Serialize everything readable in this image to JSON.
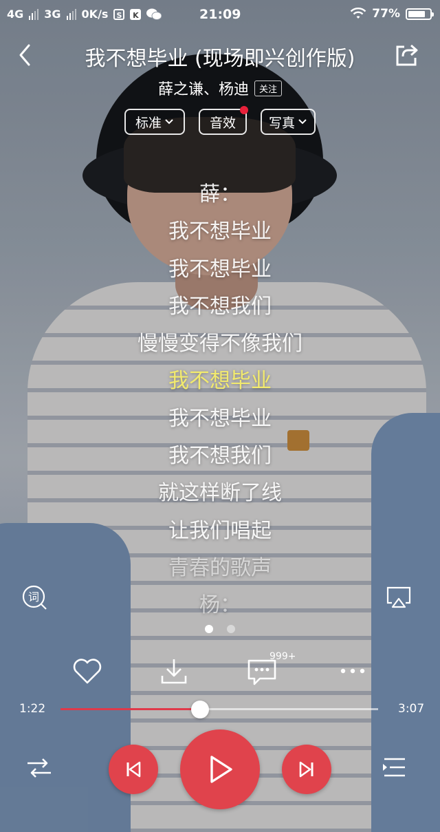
{
  "status_bar": {
    "network1": "4G",
    "network2": "3G",
    "speed": "0K/s",
    "time": "21:09",
    "battery": "77%",
    "battery_level": 0.77,
    "icons": [
      "signal-icon",
      "s-icon",
      "k-icon",
      "wechat-icon",
      "wifi-icon",
      "battery-icon"
    ]
  },
  "header": {
    "title": "我不想毕业 (现场即兴创作版)",
    "artist": "薛之谦、杨迪",
    "follow_label": "关注"
  },
  "options": {
    "quality": "标准",
    "effect": "音效",
    "photo": "写真"
  },
  "lyrics": [
    "薛：",
    "我不想毕业",
    "我不想毕业",
    "我不想我们",
    "慢慢变得不像我们",
    "我不想毕业",
    "我不想毕业",
    "我不想我们",
    "就这样断了线",
    "让我们唱起",
    "青春的歌声",
    "杨："
  ],
  "current_lyric_index": 5,
  "lyrics_button": "词",
  "comments_badge": "999+",
  "playback": {
    "elapsed": "1:22",
    "total": "3:07",
    "progress": 0.44
  },
  "colors": {
    "accent": "#e0434c",
    "highlight_lyric": "#f2ea6e",
    "progress_fill": "#e0394a"
  }
}
